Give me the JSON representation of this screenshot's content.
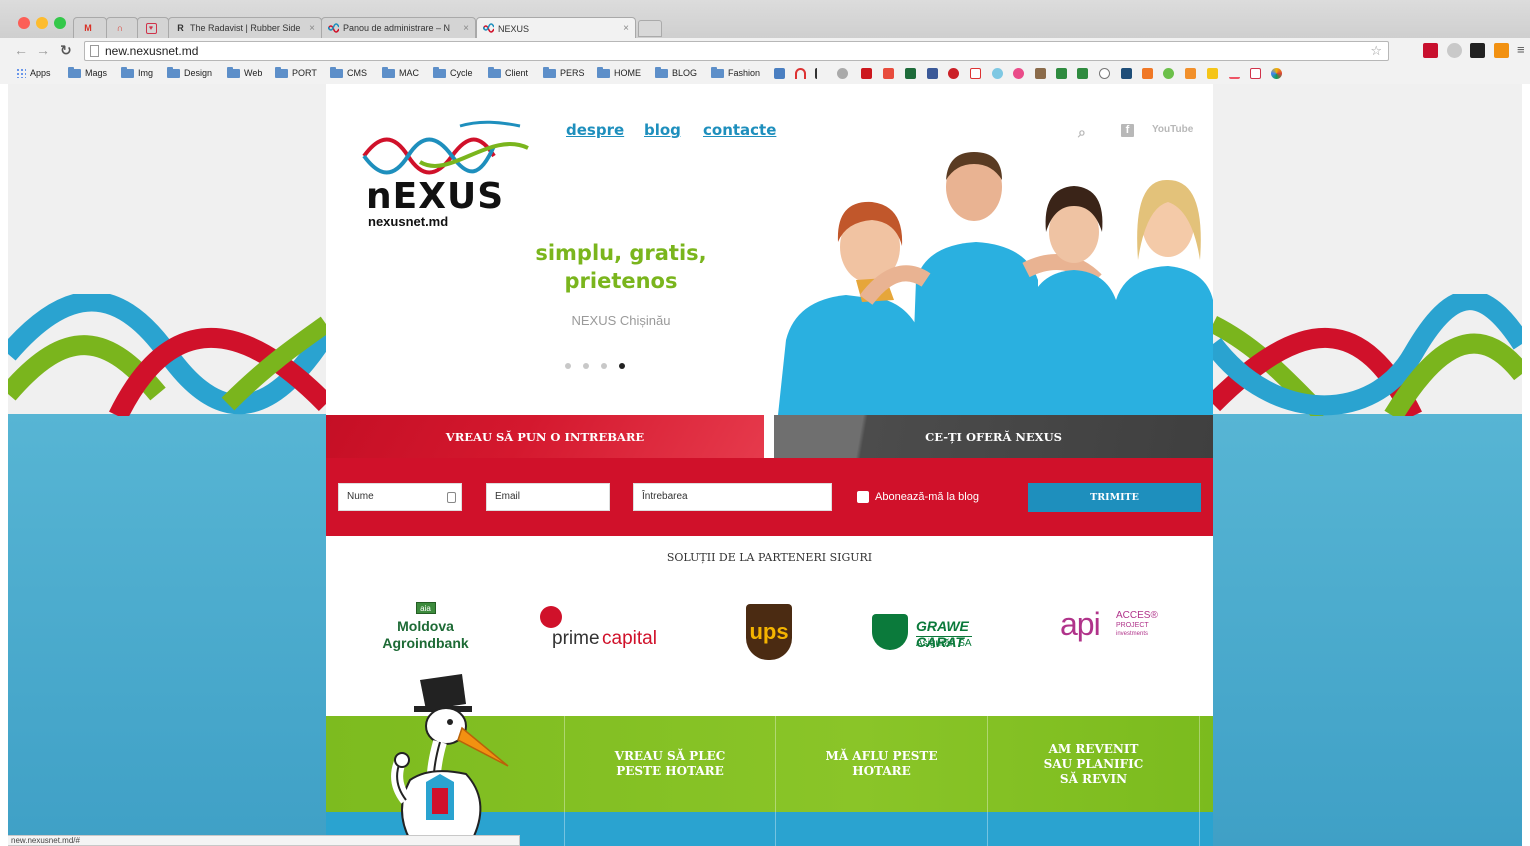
{
  "browser": {
    "tabs": [
      {
        "label": "The Radavist | Rubber Side",
        "fav": "R"
      },
      {
        "label": "Panou de administrare – N",
        "fav": "nexus-favicon"
      },
      {
        "label": "NEXUS",
        "fav": "nexus-favicon"
      }
    ],
    "url": "new.nexusnet.md",
    "bookmarks": [
      "Apps",
      "Mags",
      "Img",
      "Design",
      "Web",
      "PORT",
      "CMS",
      "MAC",
      "Cycle",
      "Client",
      "PERS",
      "HOME",
      "BLOG",
      "Fashion"
    ],
    "status_url": "new.nexusnet.md/#"
  },
  "header": {
    "logo_text": "nEXUS",
    "logo_sub": "nexusnet.md",
    "nav": [
      "despre",
      "blog",
      "contacte"
    ],
    "youtube_label": "YouTube"
  },
  "hero": {
    "slogan_line1": "simplu, gratis,",
    "slogan_line2": "prietenos",
    "subtitle": "NEXUS Chișinău",
    "slides_total": 4,
    "active_slide": 4
  },
  "tabs": {
    "question": "VREAU SĂ PUN O INTREBARE",
    "offer": "CE-ȚI OFERĂ NEXUS"
  },
  "form": {
    "name_placeholder": "Nume",
    "email_placeholder": "Email",
    "question_placeholder": "Întrebarea",
    "subscribe_label": "Abonează-mă la blog",
    "submit_label": "TRIMITE"
  },
  "partners": {
    "title": "SOLUȚII DE LA PARTENERI SIGURI",
    "moldova_line1": "Moldova",
    "moldova_line2": "Agroindbank",
    "moldova_badge": "aia",
    "prime_a": "prime",
    "prime_b": "capital",
    "ups": "ups",
    "grawe_title": "GRAWE CARAT",
    "grawe_sub": "Asigurări SA",
    "api": "api",
    "api_acces": "ACCES®",
    "api_project": "PROJECT",
    "api_inv": "investments"
  },
  "sections": [
    "VREAU SĂ PLEC\nPESTE HOTARE",
    "MĂ AFLU PESTE\nHOTARE",
    "AM REVENIT\nSAU PLANIFIC\nSĂ REVIN"
  ],
  "colors": {
    "red": "#d0112a",
    "blue": "#1e8fbd",
    "green": "#7dbb1f",
    "gray": "#3f3f3f"
  }
}
